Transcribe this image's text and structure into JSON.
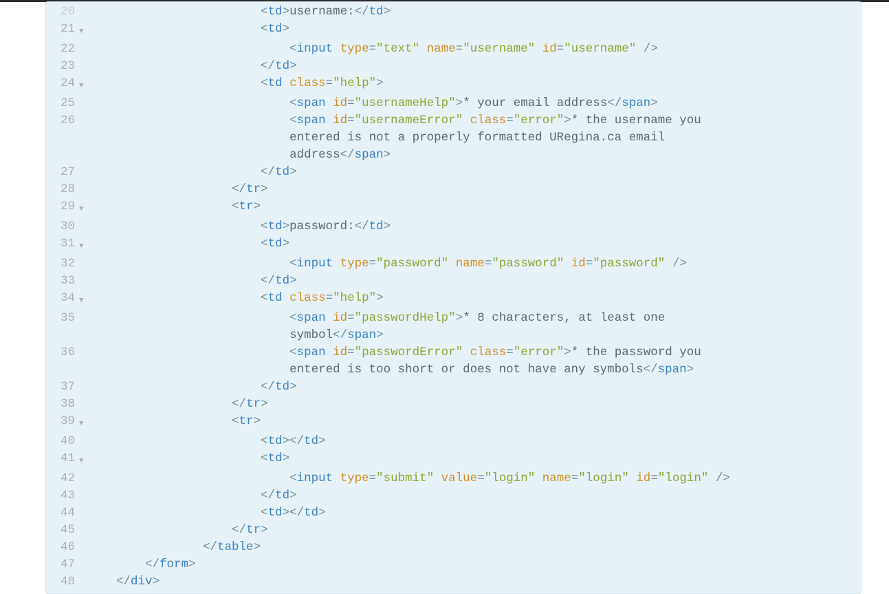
{
  "lines": [
    {
      "n": "20",
      "fold": "",
      "indent": 24,
      "half": true,
      "tokens": [
        {
          "c": "p",
          "v": "<"
        },
        {
          "c": "t",
          "v": "td"
        },
        {
          "c": "p",
          "v": ">"
        },
        {
          "c": "tx",
          "v": "username:"
        },
        {
          "c": "p",
          "v": "</"
        },
        {
          "c": "t",
          "v": "td"
        },
        {
          "c": "p",
          "v": ">"
        }
      ]
    },
    {
      "n": "21",
      "fold": "v",
      "indent": 24,
      "tokens": [
        {
          "c": "p",
          "v": "<"
        },
        {
          "c": "t",
          "v": "td"
        },
        {
          "c": "p",
          "v": ">"
        }
      ]
    },
    {
      "n": "22",
      "fold": "",
      "indent": 28,
      "tokens": [
        {
          "c": "p",
          "v": "<"
        },
        {
          "c": "t",
          "v": "input"
        },
        {
          "c": "tx",
          "v": " "
        },
        {
          "c": "a",
          "v": "type"
        },
        {
          "c": "p",
          "v": "="
        },
        {
          "c": "s",
          "v": "\"text\""
        },
        {
          "c": "tx",
          "v": " "
        },
        {
          "c": "a",
          "v": "name"
        },
        {
          "c": "p",
          "v": "="
        },
        {
          "c": "s",
          "v": "\"username\""
        },
        {
          "c": "tx",
          "v": " "
        },
        {
          "c": "a",
          "v": "id"
        },
        {
          "c": "p",
          "v": "="
        },
        {
          "c": "s",
          "v": "\"username\""
        },
        {
          "c": "tx",
          "v": " "
        },
        {
          "c": "p",
          "v": "/>"
        }
      ]
    },
    {
      "n": "23",
      "fold": "",
      "indent": 24,
      "tokens": [
        {
          "c": "p",
          "v": "</"
        },
        {
          "c": "t",
          "v": "td"
        },
        {
          "c": "p",
          "v": ">"
        }
      ]
    },
    {
      "n": "24",
      "fold": "v",
      "indent": 24,
      "tokens": [
        {
          "c": "p",
          "v": "<"
        },
        {
          "c": "t",
          "v": "td"
        },
        {
          "c": "tx",
          "v": " "
        },
        {
          "c": "a",
          "v": "class"
        },
        {
          "c": "p",
          "v": "="
        },
        {
          "c": "s",
          "v": "\"help\""
        },
        {
          "c": "p",
          "v": ">"
        }
      ]
    },
    {
      "n": "25",
      "fold": "",
      "indent": 28,
      "tokens": [
        {
          "c": "p",
          "v": "<"
        },
        {
          "c": "t",
          "v": "span"
        },
        {
          "c": "tx",
          "v": " "
        },
        {
          "c": "a",
          "v": "id"
        },
        {
          "c": "p",
          "v": "="
        },
        {
          "c": "s",
          "v": "\"usernameHelp\""
        },
        {
          "c": "p",
          "v": ">"
        },
        {
          "c": "tx",
          "v": "* your email address"
        },
        {
          "c": "p",
          "v": "</"
        },
        {
          "c": "t",
          "v": "span"
        },
        {
          "c": "p",
          "v": ">"
        }
      ]
    },
    {
      "n": "26",
      "fold": "",
      "indent": 28,
      "tokens": [
        {
          "c": "p",
          "v": "<"
        },
        {
          "c": "t",
          "v": "span"
        },
        {
          "c": "tx",
          "v": " "
        },
        {
          "c": "a",
          "v": "id"
        },
        {
          "c": "p",
          "v": "="
        },
        {
          "c": "s",
          "v": "\"usernameError\""
        },
        {
          "c": "tx",
          "v": " "
        },
        {
          "c": "a",
          "v": "class"
        },
        {
          "c": "p",
          "v": "="
        },
        {
          "c": "s",
          "v": "\"error\""
        },
        {
          "c": "p",
          "v": ">"
        },
        {
          "c": "tx",
          "v": "* the username you "
        }
      ]
    },
    {
      "n": "",
      "fold": "",
      "indent": 28,
      "wrap": true,
      "tokens": [
        {
          "c": "tx",
          "v": "entered is not a properly formatted URegina.ca email "
        }
      ]
    },
    {
      "n": "",
      "fold": "",
      "indent": 28,
      "wrap": true,
      "tokens": [
        {
          "c": "tx",
          "v": "address"
        },
        {
          "c": "p",
          "v": "</"
        },
        {
          "c": "t",
          "v": "span"
        },
        {
          "c": "p",
          "v": ">"
        }
      ]
    },
    {
      "n": "27",
      "fold": "",
      "indent": 24,
      "tokens": [
        {
          "c": "p",
          "v": "</"
        },
        {
          "c": "t",
          "v": "td"
        },
        {
          "c": "p",
          "v": ">"
        }
      ]
    },
    {
      "n": "28",
      "fold": "",
      "indent": 20,
      "tokens": [
        {
          "c": "p",
          "v": "</"
        },
        {
          "c": "t",
          "v": "tr"
        },
        {
          "c": "p",
          "v": ">"
        }
      ]
    },
    {
      "n": "29",
      "fold": "v",
      "indent": 20,
      "tokens": [
        {
          "c": "p",
          "v": "<"
        },
        {
          "c": "t",
          "v": "tr"
        },
        {
          "c": "p",
          "v": ">"
        }
      ]
    },
    {
      "n": "30",
      "fold": "",
      "indent": 24,
      "tokens": [
        {
          "c": "p",
          "v": "<"
        },
        {
          "c": "t",
          "v": "td"
        },
        {
          "c": "p",
          "v": ">"
        },
        {
          "c": "tx",
          "v": "password:"
        },
        {
          "c": "p",
          "v": "</"
        },
        {
          "c": "t",
          "v": "td"
        },
        {
          "c": "p",
          "v": ">"
        }
      ]
    },
    {
      "n": "31",
      "fold": "v",
      "indent": 24,
      "tokens": [
        {
          "c": "p",
          "v": "<"
        },
        {
          "c": "t",
          "v": "td"
        },
        {
          "c": "p",
          "v": ">"
        }
      ]
    },
    {
      "n": "32",
      "fold": "",
      "indent": 28,
      "tokens": [
        {
          "c": "p",
          "v": "<"
        },
        {
          "c": "t",
          "v": "input"
        },
        {
          "c": "tx",
          "v": " "
        },
        {
          "c": "a",
          "v": "type"
        },
        {
          "c": "p",
          "v": "="
        },
        {
          "c": "s",
          "v": "\"password\""
        },
        {
          "c": "tx",
          "v": " "
        },
        {
          "c": "a",
          "v": "name"
        },
        {
          "c": "p",
          "v": "="
        },
        {
          "c": "s",
          "v": "\"password\""
        },
        {
          "c": "tx",
          "v": " "
        },
        {
          "c": "a",
          "v": "id"
        },
        {
          "c": "p",
          "v": "="
        },
        {
          "c": "s",
          "v": "\"password\""
        },
        {
          "c": "tx",
          "v": " "
        },
        {
          "c": "p",
          "v": "/>"
        }
      ]
    },
    {
      "n": "33",
      "fold": "",
      "indent": 24,
      "tokens": [
        {
          "c": "p",
          "v": "</"
        },
        {
          "c": "t",
          "v": "td"
        },
        {
          "c": "p",
          "v": ">"
        }
      ]
    },
    {
      "n": "34",
      "fold": "v",
      "indent": 24,
      "tokens": [
        {
          "c": "p",
          "v": "<"
        },
        {
          "c": "t",
          "v": "td"
        },
        {
          "c": "tx",
          "v": " "
        },
        {
          "c": "a",
          "v": "class"
        },
        {
          "c": "p",
          "v": "="
        },
        {
          "c": "s",
          "v": "\"help\""
        },
        {
          "c": "p",
          "v": ">"
        }
      ]
    },
    {
      "n": "35",
      "fold": "",
      "indent": 28,
      "tokens": [
        {
          "c": "p",
          "v": "<"
        },
        {
          "c": "t",
          "v": "span"
        },
        {
          "c": "tx",
          "v": " "
        },
        {
          "c": "a",
          "v": "id"
        },
        {
          "c": "p",
          "v": "="
        },
        {
          "c": "s",
          "v": "\"passwordHelp\""
        },
        {
          "c": "p",
          "v": ">"
        },
        {
          "c": "tx",
          "v": "* 8 characters, at least one "
        }
      ]
    },
    {
      "n": "",
      "fold": "",
      "indent": 28,
      "wrap": true,
      "tokens": [
        {
          "c": "tx",
          "v": "symbol"
        },
        {
          "c": "p",
          "v": "</"
        },
        {
          "c": "t",
          "v": "span"
        },
        {
          "c": "p",
          "v": ">"
        }
      ]
    },
    {
      "n": "36",
      "fold": "",
      "indent": 28,
      "tokens": [
        {
          "c": "p",
          "v": "<"
        },
        {
          "c": "t",
          "v": "span"
        },
        {
          "c": "tx",
          "v": " "
        },
        {
          "c": "a",
          "v": "id"
        },
        {
          "c": "p",
          "v": "="
        },
        {
          "c": "s",
          "v": "\"passwordError\""
        },
        {
          "c": "tx",
          "v": " "
        },
        {
          "c": "a",
          "v": "class"
        },
        {
          "c": "p",
          "v": "="
        },
        {
          "c": "s",
          "v": "\"error\""
        },
        {
          "c": "p",
          "v": ">"
        },
        {
          "c": "tx",
          "v": "* the password you "
        }
      ]
    },
    {
      "n": "",
      "fold": "",
      "indent": 28,
      "wrap": true,
      "tokens": [
        {
          "c": "tx",
          "v": "entered is too short or does not have any symbols"
        },
        {
          "c": "p",
          "v": "</"
        },
        {
          "c": "t",
          "v": "span"
        },
        {
          "c": "p",
          "v": ">"
        }
      ]
    },
    {
      "n": "37",
      "fold": "",
      "indent": 24,
      "tokens": [
        {
          "c": "p",
          "v": "</"
        },
        {
          "c": "t",
          "v": "td"
        },
        {
          "c": "p",
          "v": ">"
        }
      ]
    },
    {
      "n": "38",
      "fold": "",
      "indent": 20,
      "tokens": [
        {
          "c": "p",
          "v": "</"
        },
        {
          "c": "t",
          "v": "tr"
        },
        {
          "c": "p",
          "v": ">"
        }
      ]
    },
    {
      "n": "39",
      "fold": "v",
      "indent": 20,
      "tokens": [
        {
          "c": "p",
          "v": "<"
        },
        {
          "c": "t",
          "v": "tr"
        },
        {
          "c": "p",
          "v": ">"
        }
      ]
    },
    {
      "n": "40",
      "fold": "",
      "indent": 24,
      "tokens": [
        {
          "c": "p",
          "v": "<"
        },
        {
          "c": "t",
          "v": "td"
        },
        {
          "c": "p",
          "v": ">"
        },
        {
          "c": "p",
          "v": "</"
        },
        {
          "c": "t",
          "v": "td"
        },
        {
          "c": "p",
          "v": ">"
        }
      ]
    },
    {
      "n": "41",
      "fold": "v",
      "indent": 24,
      "tokens": [
        {
          "c": "p",
          "v": "<"
        },
        {
          "c": "t",
          "v": "td"
        },
        {
          "c": "p",
          "v": ">"
        }
      ]
    },
    {
      "n": "42",
      "fold": "",
      "indent": 28,
      "tokens": [
        {
          "c": "p",
          "v": "<"
        },
        {
          "c": "t",
          "v": "input"
        },
        {
          "c": "tx",
          "v": " "
        },
        {
          "c": "a",
          "v": "type"
        },
        {
          "c": "p",
          "v": "="
        },
        {
          "c": "s",
          "v": "\"submit\""
        },
        {
          "c": "tx",
          "v": " "
        },
        {
          "c": "a",
          "v": "value"
        },
        {
          "c": "p",
          "v": "="
        },
        {
          "c": "s",
          "v": "\"login\""
        },
        {
          "c": "tx",
          "v": " "
        },
        {
          "c": "a",
          "v": "name"
        },
        {
          "c": "p",
          "v": "="
        },
        {
          "c": "s",
          "v": "\"login\""
        },
        {
          "c": "tx",
          "v": " "
        },
        {
          "c": "a",
          "v": "id"
        },
        {
          "c": "p",
          "v": "="
        },
        {
          "c": "s",
          "v": "\"login\""
        },
        {
          "c": "tx",
          "v": " "
        },
        {
          "c": "p",
          "v": "/>"
        }
      ]
    },
    {
      "n": "43",
      "fold": "",
      "indent": 24,
      "tokens": [
        {
          "c": "p",
          "v": "</"
        },
        {
          "c": "t",
          "v": "td"
        },
        {
          "c": "p",
          "v": ">"
        }
      ]
    },
    {
      "n": "44",
      "fold": "",
      "indent": 24,
      "tokens": [
        {
          "c": "p",
          "v": "<"
        },
        {
          "c": "t",
          "v": "td"
        },
        {
          "c": "p",
          "v": ">"
        },
        {
          "c": "p",
          "v": "</"
        },
        {
          "c": "t",
          "v": "td"
        },
        {
          "c": "p",
          "v": ">"
        }
      ]
    },
    {
      "n": "45",
      "fold": "",
      "indent": 20,
      "tokens": [
        {
          "c": "p",
          "v": "</"
        },
        {
          "c": "t",
          "v": "tr"
        },
        {
          "c": "p",
          "v": ">"
        }
      ]
    },
    {
      "n": "46",
      "fold": "",
      "indent": 16,
      "tokens": [
        {
          "c": "p",
          "v": "</"
        },
        {
          "c": "t",
          "v": "table"
        },
        {
          "c": "p",
          "v": ">"
        }
      ]
    },
    {
      "n": "47",
      "fold": "",
      "indent": 8,
      "tokens": [
        {
          "c": "p",
          "v": "</"
        },
        {
          "c": "t",
          "v": "form"
        },
        {
          "c": "p",
          "v": ">"
        }
      ]
    },
    {
      "n": "48",
      "fold": "",
      "indent": 4,
      "tokens": [
        {
          "c": "p",
          "v": "</"
        },
        {
          "c": "t",
          "v": "div"
        },
        {
          "c": "p",
          "v": ">"
        }
      ]
    }
  ]
}
